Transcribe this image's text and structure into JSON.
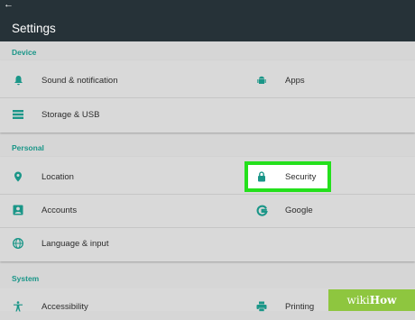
{
  "header": {
    "back_icon": "back-arrow-icon",
    "title": "Settings"
  },
  "sections": {
    "device": {
      "title": "Device",
      "items": [
        {
          "label": "Sound & notification",
          "icon": "bell-icon"
        },
        {
          "label": "Apps",
          "icon": "android-icon"
        },
        {
          "label": "Storage & USB",
          "icon": "storage-icon"
        }
      ]
    },
    "personal": {
      "title": "Personal",
      "items": [
        {
          "label": "Location",
          "icon": "location-pin-icon"
        },
        {
          "label": "Security",
          "icon": "lock-icon"
        },
        {
          "label": "Accounts",
          "icon": "account-icon"
        },
        {
          "label": "Google",
          "icon": "google-icon"
        },
        {
          "label": "Language & input",
          "icon": "globe-icon"
        }
      ]
    },
    "system": {
      "title": "System",
      "items": [
        {
          "label": "Accessibility",
          "icon": "accessibility-icon"
        },
        {
          "label": "Printing",
          "icon": "printer-icon"
        }
      ]
    }
  },
  "watermark": {
    "wiki": "wiki",
    "how": "How"
  },
  "colors": {
    "accent": "#1a9688",
    "toolbar": "#263238",
    "highlight": "#24e01c"
  }
}
